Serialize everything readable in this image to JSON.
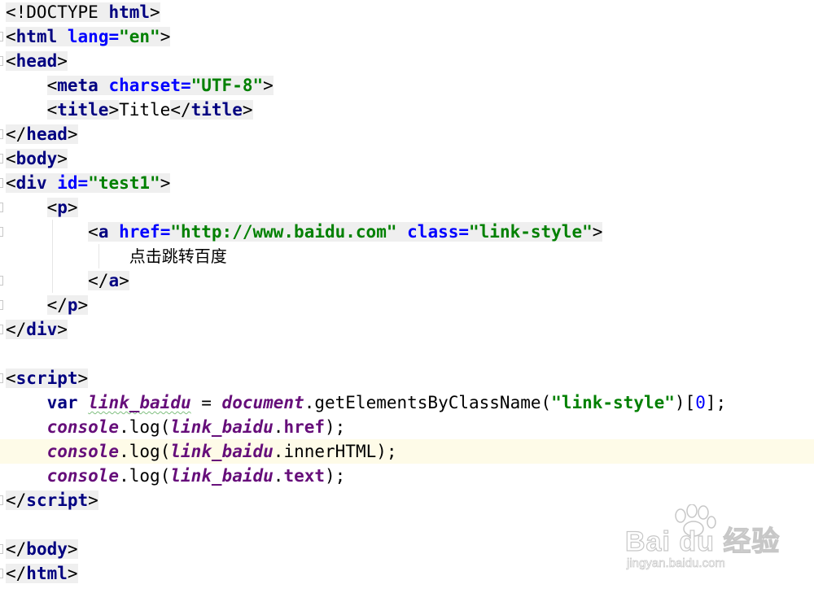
{
  "editor": {
    "language": "html",
    "current_line_index": 18,
    "lines": [
      {
        "segments": [
          {
            "t": "<!DOCTYPE ",
            "c": "tk-punct",
            "bg": true
          },
          {
            "t": "html",
            "c": "tk-tag",
            "bg": true
          },
          {
            "t": ">",
            "c": "tk-punct",
            "bg": true
          }
        ]
      },
      {
        "fold": true,
        "segments": [
          {
            "t": "<",
            "c": "tk-punct",
            "bg": true
          },
          {
            "t": "html",
            "c": "tk-tag",
            "bg": true
          },
          {
            "t": " ",
            "c": "tk-punct",
            "bg": true
          },
          {
            "t": "lang=",
            "c": "tk-attr",
            "bg": true
          },
          {
            "t": "\"en\"",
            "c": "tk-str",
            "bg": true
          },
          {
            "t": ">",
            "c": "tk-punct",
            "bg": true
          }
        ]
      },
      {
        "fold": true,
        "segments": [
          {
            "t": "<",
            "c": "tk-punct",
            "bg": true
          },
          {
            "t": "head",
            "c": "tk-tag",
            "bg": true
          },
          {
            "t": ">",
            "c": "tk-punct",
            "bg": true
          }
        ]
      },
      {
        "segments": [
          {
            "t": "    ",
            "c": "tk-text"
          },
          {
            "t": "<",
            "c": "tk-punct",
            "bg": true
          },
          {
            "t": "meta",
            "c": "tk-tag",
            "bg": true
          },
          {
            "t": " ",
            "c": "tk-punct",
            "bg": true
          },
          {
            "t": "charset=",
            "c": "tk-attr",
            "bg": true
          },
          {
            "t": "\"UTF-8\"",
            "c": "tk-str",
            "bg": true
          },
          {
            "t": ">",
            "c": "tk-punct",
            "bg": true
          }
        ]
      },
      {
        "segments": [
          {
            "t": "    ",
            "c": "tk-text"
          },
          {
            "t": "<",
            "c": "tk-punct",
            "bg": true
          },
          {
            "t": "title",
            "c": "tk-tag",
            "bg": true
          },
          {
            "t": ">",
            "c": "tk-punct",
            "bg": true
          },
          {
            "t": "Title",
            "c": "tk-text"
          },
          {
            "t": "</",
            "c": "tk-punct",
            "bg": true
          },
          {
            "t": "title",
            "c": "tk-tag",
            "bg": true
          },
          {
            "t": ">",
            "c": "tk-punct",
            "bg": true
          }
        ]
      },
      {
        "fold": true,
        "segments": [
          {
            "t": "</",
            "c": "tk-punct",
            "bg": true
          },
          {
            "t": "head",
            "c": "tk-tag",
            "bg": true
          },
          {
            "t": ">",
            "c": "tk-punct",
            "bg": true
          }
        ]
      },
      {
        "fold": true,
        "segments": [
          {
            "t": "<",
            "c": "tk-punct",
            "bg": true
          },
          {
            "t": "body",
            "c": "tk-tag",
            "bg": true
          },
          {
            "t": ">",
            "c": "tk-punct",
            "bg": true
          }
        ]
      },
      {
        "fold": true,
        "segments": [
          {
            "t": "<",
            "c": "tk-punct",
            "bg": true
          },
          {
            "t": "div",
            "c": "tk-tag",
            "bg": true
          },
          {
            "t": " ",
            "c": "tk-punct",
            "bg": true
          },
          {
            "t": "id=",
            "c": "tk-attr",
            "bg": true
          },
          {
            "t": "\"test1\"",
            "c": "tk-str",
            "bg": true
          },
          {
            "t": ">",
            "c": "tk-punct",
            "bg": true
          }
        ]
      },
      {
        "fold": true,
        "segments": [
          {
            "t": "    ",
            "c": "tk-text"
          },
          {
            "t": "<",
            "c": "tk-punct",
            "bg": true
          },
          {
            "t": "p",
            "c": "tk-tag",
            "bg": true
          },
          {
            "t": ">",
            "c": "tk-punct",
            "bg": true
          }
        ]
      },
      {
        "fold": true,
        "segments": [
          {
            "t": "        ",
            "c": "tk-text"
          },
          {
            "t": "<",
            "c": "tk-punct",
            "bg": true
          },
          {
            "t": "a",
            "c": "tk-tag",
            "bg": true
          },
          {
            "t": " ",
            "c": "tk-punct",
            "bg": true
          },
          {
            "t": "href=",
            "c": "tk-attr",
            "bg": true
          },
          {
            "t": "\"http://www.baidu.com\"",
            "c": "tk-str",
            "bg": true
          },
          {
            "t": " ",
            "c": "tk-punct",
            "bg": true
          },
          {
            "t": "class=",
            "c": "tk-attr",
            "bg": true
          },
          {
            "t": "\"link-style\"",
            "c": "tk-str",
            "bg": true
          },
          {
            "t": ">",
            "c": "tk-punct",
            "bg": true
          }
        ]
      },
      {
        "segments": [
          {
            "t": "            ",
            "c": "tk-text"
          },
          {
            "t": "点击跳转百度",
            "c": "tk-text tk-cjk"
          }
        ]
      },
      {
        "fold": true,
        "segments": [
          {
            "t": "        ",
            "c": "tk-text"
          },
          {
            "t": "</",
            "c": "tk-punct",
            "bg": true
          },
          {
            "t": "a",
            "c": "tk-tag",
            "bg": true
          },
          {
            "t": ">",
            "c": "tk-punct",
            "bg": true
          }
        ]
      },
      {
        "fold": true,
        "segments": [
          {
            "t": "    ",
            "c": "tk-text"
          },
          {
            "t": "</",
            "c": "tk-punct",
            "bg": true
          },
          {
            "t": "p",
            "c": "tk-tag",
            "bg": true
          },
          {
            "t": ">",
            "c": "tk-punct",
            "bg": true
          }
        ]
      },
      {
        "fold": true,
        "segments": [
          {
            "t": "</",
            "c": "tk-punct",
            "bg": true
          },
          {
            "t": "div",
            "c": "tk-tag",
            "bg": true
          },
          {
            "t": ">",
            "c": "tk-punct",
            "bg": true
          }
        ]
      },
      {
        "segments": []
      },
      {
        "fold": true,
        "segments": [
          {
            "t": "<",
            "c": "tk-punct",
            "bg": true
          },
          {
            "t": "script",
            "c": "tk-tag",
            "bg": true
          },
          {
            "t": ">",
            "c": "tk-punct",
            "bg": true
          }
        ]
      },
      {
        "segments": [
          {
            "t": "    ",
            "c": "tk-text"
          },
          {
            "t": "var",
            "c": "tk-kw"
          },
          {
            "t": " ",
            "c": "tk-text"
          },
          {
            "t": "link_baidu",
            "c": "tk-var squiggle"
          },
          {
            "t": " = ",
            "c": "tk-text"
          },
          {
            "t": "document",
            "c": "tk-glob"
          },
          {
            "t": ".",
            "c": "tk-text"
          },
          {
            "t": "getElementsByClassName",
            "c": "tk-fn"
          },
          {
            "t": "(",
            "c": "tk-text"
          },
          {
            "t": "\"link-style\"",
            "c": "tk-str"
          },
          {
            "t": ")[",
            "c": "tk-text"
          },
          {
            "t": "0",
            "c": "tk-num"
          },
          {
            "t": "];",
            "c": "tk-text"
          }
        ]
      },
      {
        "segments": [
          {
            "t": "    ",
            "c": "tk-text"
          },
          {
            "t": "console",
            "c": "tk-glob"
          },
          {
            "t": ".",
            "c": "tk-text"
          },
          {
            "t": "log",
            "c": "tk-fn"
          },
          {
            "t": "(",
            "c": "tk-text"
          },
          {
            "t": "link_baidu",
            "c": "tk-var"
          },
          {
            "t": ".",
            "c": "tk-text"
          },
          {
            "t": "href",
            "c": "tk-prop"
          },
          {
            "t": ");",
            "c": "tk-text"
          }
        ]
      },
      {
        "segments": [
          {
            "t": "    ",
            "c": "tk-text"
          },
          {
            "t": "console",
            "c": "tk-glob"
          },
          {
            "t": ".",
            "c": "tk-text"
          },
          {
            "t": "log",
            "c": "tk-fn"
          },
          {
            "t": "(",
            "c": "tk-text"
          },
          {
            "t": "link_baidu",
            "c": "tk-var"
          },
          {
            "t": ".",
            "c": "tk-text"
          },
          {
            "t": "innerHTML",
            "c": "tk-fn"
          },
          {
            "t": ");",
            "c": "tk-text"
          }
        ]
      },
      {
        "segments": [
          {
            "t": "    ",
            "c": "tk-text"
          },
          {
            "t": "console",
            "c": "tk-glob"
          },
          {
            "t": ".",
            "c": "tk-text"
          },
          {
            "t": "log",
            "c": "tk-fn"
          },
          {
            "t": "(",
            "c": "tk-text"
          },
          {
            "t": "link_baidu",
            "c": "tk-var"
          },
          {
            "t": ".",
            "c": "tk-text"
          },
          {
            "t": "text",
            "c": "tk-prop"
          },
          {
            "t": ");",
            "c": "tk-text"
          }
        ]
      },
      {
        "fold": true,
        "segments": [
          {
            "t": "</",
            "c": "tk-punct",
            "bg": true
          },
          {
            "t": "script",
            "c": "tk-tag",
            "bg": true
          },
          {
            "t": ">",
            "c": "tk-punct",
            "bg": true
          }
        ]
      },
      {
        "segments": []
      },
      {
        "fold": true,
        "segments": [
          {
            "t": "</",
            "c": "tk-punct",
            "bg": true
          },
          {
            "t": "body",
            "c": "tk-tag",
            "bg": true
          },
          {
            "t": ">",
            "c": "tk-punct",
            "bg": true
          }
        ]
      },
      {
        "fold": true,
        "segments": [
          {
            "t": "</",
            "c": "tk-punct",
            "bg": true
          },
          {
            "t": "html",
            "c": "tk-tag",
            "bg": true
          },
          {
            "t": ">",
            "c": "tk-punct",
            "bg": true
          }
        ]
      }
    ]
  },
  "watermark": {
    "brand": "Bai du 经验",
    "sub": "jingyan.baidu.com"
  },
  "colors": {
    "tag": "#000080",
    "attribute": "#0000ff",
    "string": "#008000",
    "variable": "#660e7a",
    "current_line": "#fefbe8",
    "tag_background": "#efefef"
  }
}
